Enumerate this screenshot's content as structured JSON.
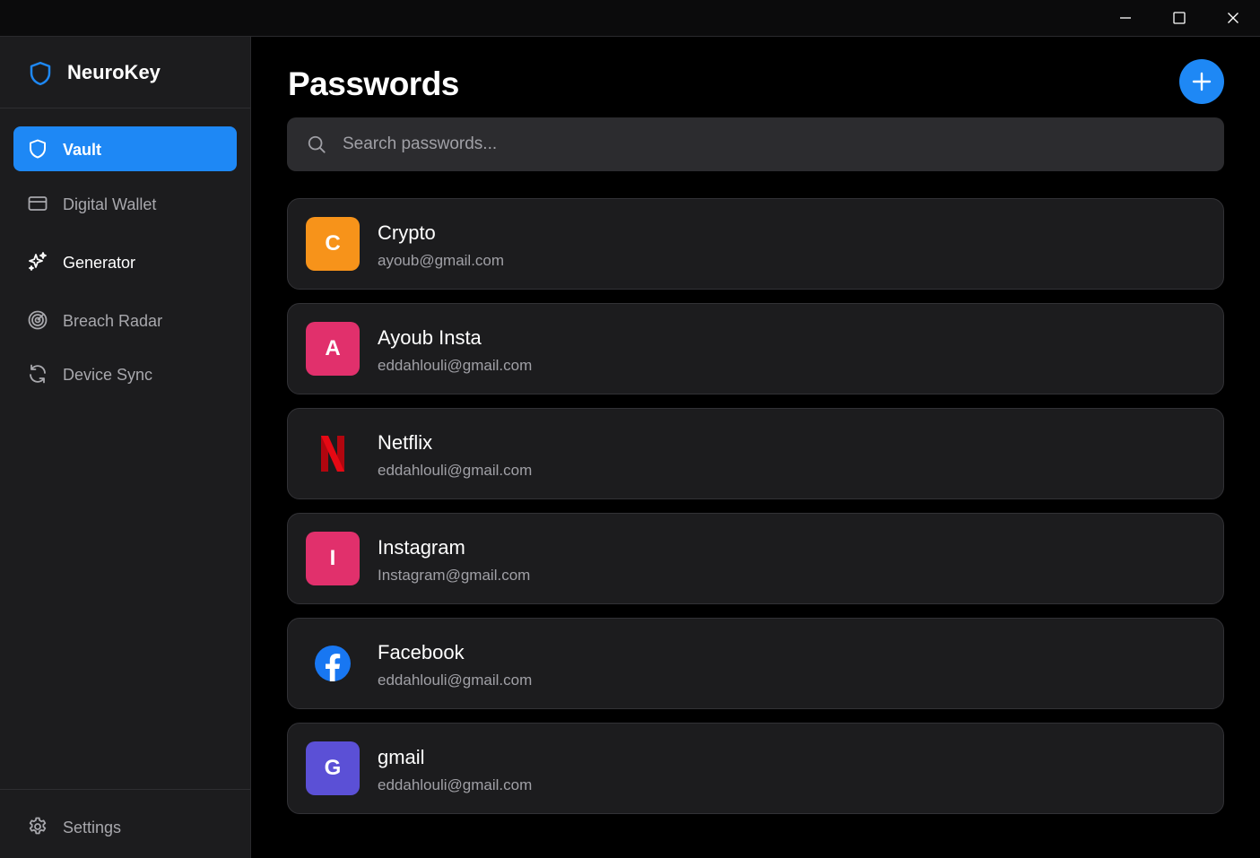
{
  "window": {
    "controls": [
      "minimize",
      "maximize",
      "close"
    ]
  },
  "app": {
    "name": "NeuroKey",
    "accent": "#1e88f5"
  },
  "sidebar": {
    "items": [
      {
        "label": "Vault",
        "icon": "shield-icon",
        "active": true
      },
      {
        "label": "Digital Wallet",
        "icon": "card-icon",
        "active": false
      },
      {
        "label": "Generator",
        "icon": "sparkles-icon",
        "active": false
      },
      {
        "label": "Breach Radar",
        "icon": "radar-icon",
        "active": false
      },
      {
        "label": "Device Sync",
        "icon": "sync-icon",
        "active": false
      }
    ],
    "footer": {
      "label": "Settings",
      "icon": "gear-icon"
    }
  },
  "main": {
    "title": "Passwords",
    "add_icon": "plus-icon",
    "search": {
      "placeholder": "Search passwords...",
      "value": ""
    }
  },
  "passwords": [
    {
      "initial": "C",
      "title": "Crypto",
      "email": "ayoub@gmail.com",
      "color": "#f7931a"
    },
    {
      "initial": "A",
      "title": "Ayoub Insta",
      "email": "eddahlouli@gmail.com",
      "color": "#e1306c"
    },
    {
      "initial": "",
      "title": "Netflix",
      "email": "eddahlouli@gmail.com",
      "logo": "netflix-logo-icon"
    },
    {
      "initial": "I",
      "title": "Instagram",
      "email": "Instagram@gmail.com",
      "color": "#e1306c"
    },
    {
      "initial": "",
      "title": "Facebook",
      "email": "eddahlouli@gmail.com",
      "logo": "facebook-logo-icon"
    },
    {
      "initial": "G",
      "title": "gmail",
      "email": "eddahlouli@gmail.com",
      "color": "#5b50d6"
    }
  ]
}
